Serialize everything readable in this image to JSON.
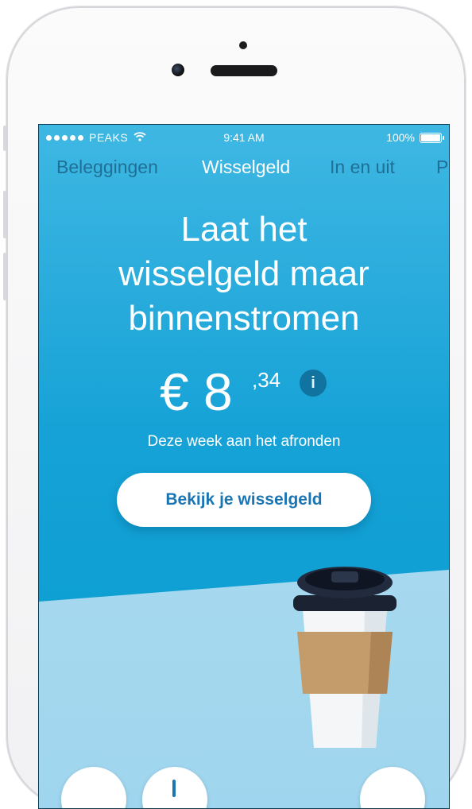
{
  "statusbar": {
    "carrier": "PEAKS",
    "time": "9:41 AM",
    "battery": "100%"
  },
  "tabs": [
    {
      "label": "Beleggingen"
    },
    {
      "label": "Wisselgeld"
    },
    {
      "label": "In en uit"
    },
    {
      "label": "P"
    }
  ],
  "hero": {
    "title_line1": "Laat het",
    "title_line2": "wisselgeld maar",
    "title_line3": "binnenstromen",
    "amount_main": "€ 8",
    "amount_cents": ",34",
    "info": "i",
    "subtitle": "Deze week aan het afronden"
  },
  "cta": {
    "label": "Bekijk je wisselgeld"
  },
  "colors": {
    "accent": "#1c75b3",
    "screen_bg": "#16a2d6",
    "tab_inactive": "#1f6f96"
  }
}
